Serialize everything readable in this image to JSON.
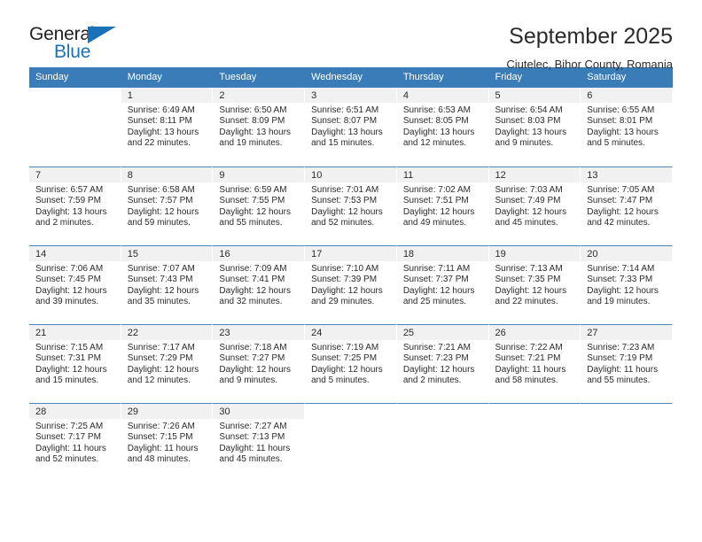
{
  "brand": {
    "name_part1": "General",
    "name_part2": "Blue",
    "accent_color": "#1b72b8"
  },
  "header": {
    "title": "September 2025",
    "subtitle": "Ciutelec, Bihor County, Romania"
  },
  "calendar": {
    "header_bg": "#3a7cb8",
    "daynum_bg": "#f1f1f1",
    "weekday_headers": [
      "Sunday",
      "Monday",
      "Tuesday",
      "Wednesday",
      "Thursday",
      "Friday",
      "Saturday"
    ],
    "weeks": [
      [
        {
          "day": "",
          "sunrise": "",
          "sunset": "",
          "daylight": ""
        },
        {
          "day": "1",
          "sunrise": "Sunrise: 6:49 AM",
          "sunset": "Sunset: 8:11 PM",
          "daylight": "Daylight: 13 hours and 22 minutes."
        },
        {
          "day": "2",
          "sunrise": "Sunrise: 6:50 AM",
          "sunset": "Sunset: 8:09 PM",
          "daylight": "Daylight: 13 hours and 19 minutes."
        },
        {
          "day": "3",
          "sunrise": "Sunrise: 6:51 AM",
          "sunset": "Sunset: 8:07 PM",
          "daylight": "Daylight: 13 hours and 15 minutes."
        },
        {
          "day": "4",
          "sunrise": "Sunrise: 6:53 AM",
          "sunset": "Sunset: 8:05 PM",
          "daylight": "Daylight: 13 hours and 12 minutes."
        },
        {
          "day": "5",
          "sunrise": "Sunrise: 6:54 AM",
          "sunset": "Sunset: 8:03 PM",
          "daylight": "Daylight: 13 hours and 9 minutes."
        },
        {
          "day": "6",
          "sunrise": "Sunrise: 6:55 AM",
          "sunset": "Sunset: 8:01 PM",
          "daylight": "Daylight: 13 hours and 5 minutes."
        }
      ],
      [
        {
          "day": "7",
          "sunrise": "Sunrise: 6:57 AM",
          "sunset": "Sunset: 7:59 PM",
          "daylight": "Daylight: 13 hours and 2 minutes."
        },
        {
          "day": "8",
          "sunrise": "Sunrise: 6:58 AM",
          "sunset": "Sunset: 7:57 PM",
          "daylight": "Daylight: 12 hours and 59 minutes."
        },
        {
          "day": "9",
          "sunrise": "Sunrise: 6:59 AM",
          "sunset": "Sunset: 7:55 PM",
          "daylight": "Daylight: 12 hours and 55 minutes."
        },
        {
          "day": "10",
          "sunrise": "Sunrise: 7:01 AM",
          "sunset": "Sunset: 7:53 PM",
          "daylight": "Daylight: 12 hours and 52 minutes."
        },
        {
          "day": "11",
          "sunrise": "Sunrise: 7:02 AM",
          "sunset": "Sunset: 7:51 PM",
          "daylight": "Daylight: 12 hours and 49 minutes."
        },
        {
          "day": "12",
          "sunrise": "Sunrise: 7:03 AM",
          "sunset": "Sunset: 7:49 PM",
          "daylight": "Daylight: 12 hours and 45 minutes."
        },
        {
          "day": "13",
          "sunrise": "Sunrise: 7:05 AM",
          "sunset": "Sunset: 7:47 PM",
          "daylight": "Daylight: 12 hours and 42 minutes."
        }
      ],
      [
        {
          "day": "14",
          "sunrise": "Sunrise: 7:06 AM",
          "sunset": "Sunset: 7:45 PM",
          "daylight": "Daylight: 12 hours and 39 minutes."
        },
        {
          "day": "15",
          "sunrise": "Sunrise: 7:07 AM",
          "sunset": "Sunset: 7:43 PM",
          "daylight": "Daylight: 12 hours and 35 minutes."
        },
        {
          "day": "16",
          "sunrise": "Sunrise: 7:09 AM",
          "sunset": "Sunset: 7:41 PM",
          "daylight": "Daylight: 12 hours and 32 minutes."
        },
        {
          "day": "17",
          "sunrise": "Sunrise: 7:10 AM",
          "sunset": "Sunset: 7:39 PM",
          "daylight": "Daylight: 12 hours and 29 minutes."
        },
        {
          "day": "18",
          "sunrise": "Sunrise: 7:11 AM",
          "sunset": "Sunset: 7:37 PM",
          "daylight": "Daylight: 12 hours and 25 minutes."
        },
        {
          "day": "19",
          "sunrise": "Sunrise: 7:13 AM",
          "sunset": "Sunset: 7:35 PM",
          "daylight": "Daylight: 12 hours and 22 minutes."
        },
        {
          "day": "20",
          "sunrise": "Sunrise: 7:14 AM",
          "sunset": "Sunset: 7:33 PM",
          "daylight": "Daylight: 12 hours and 19 minutes."
        }
      ],
      [
        {
          "day": "21",
          "sunrise": "Sunrise: 7:15 AM",
          "sunset": "Sunset: 7:31 PM",
          "daylight": "Daylight: 12 hours and 15 minutes."
        },
        {
          "day": "22",
          "sunrise": "Sunrise: 7:17 AM",
          "sunset": "Sunset: 7:29 PM",
          "daylight": "Daylight: 12 hours and 12 minutes."
        },
        {
          "day": "23",
          "sunrise": "Sunrise: 7:18 AM",
          "sunset": "Sunset: 7:27 PM",
          "daylight": "Daylight: 12 hours and 9 minutes."
        },
        {
          "day": "24",
          "sunrise": "Sunrise: 7:19 AM",
          "sunset": "Sunset: 7:25 PM",
          "daylight": "Daylight: 12 hours and 5 minutes."
        },
        {
          "day": "25",
          "sunrise": "Sunrise: 7:21 AM",
          "sunset": "Sunset: 7:23 PM",
          "daylight": "Daylight: 12 hours and 2 minutes."
        },
        {
          "day": "26",
          "sunrise": "Sunrise: 7:22 AM",
          "sunset": "Sunset: 7:21 PM",
          "daylight": "Daylight: 11 hours and 58 minutes."
        },
        {
          "day": "27",
          "sunrise": "Sunrise: 7:23 AM",
          "sunset": "Sunset: 7:19 PM",
          "daylight": "Daylight: 11 hours and 55 minutes."
        }
      ],
      [
        {
          "day": "28",
          "sunrise": "Sunrise: 7:25 AM",
          "sunset": "Sunset: 7:17 PM",
          "daylight": "Daylight: 11 hours and 52 minutes."
        },
        {
          "day": "29",
          "sunrise": "Sunrise: 7:26 AM",
          "sunset": "Sunset: 7:15 PM",
          "daylight": "Daylight: 11 hours and 48 minutes."
        },
        {
          "day": "30",
          "sunrise": "Sunrise: 7:27 AM",
          "sunset": "Sunset: 7:13 PM",
          "daylight": "Daylight: 11 hours and 45 minutes."
        },
        {
          "day": "",
          "sunrise": "",
          "sunset": "",
          "daylight": ""
        },
        {
          "day": "",
          "sunrise": "",
          "sunset": "",
          "daylight": ""
        },
        {
          "day": "",
          "sunrise": "",
          "sunset": "",
          "daylight": ""
        },
        {
          "day": "",
          "sunrise": "",
          "sunset": "",
          "daylight": ""
        }
      ]
    ]
  }
}
